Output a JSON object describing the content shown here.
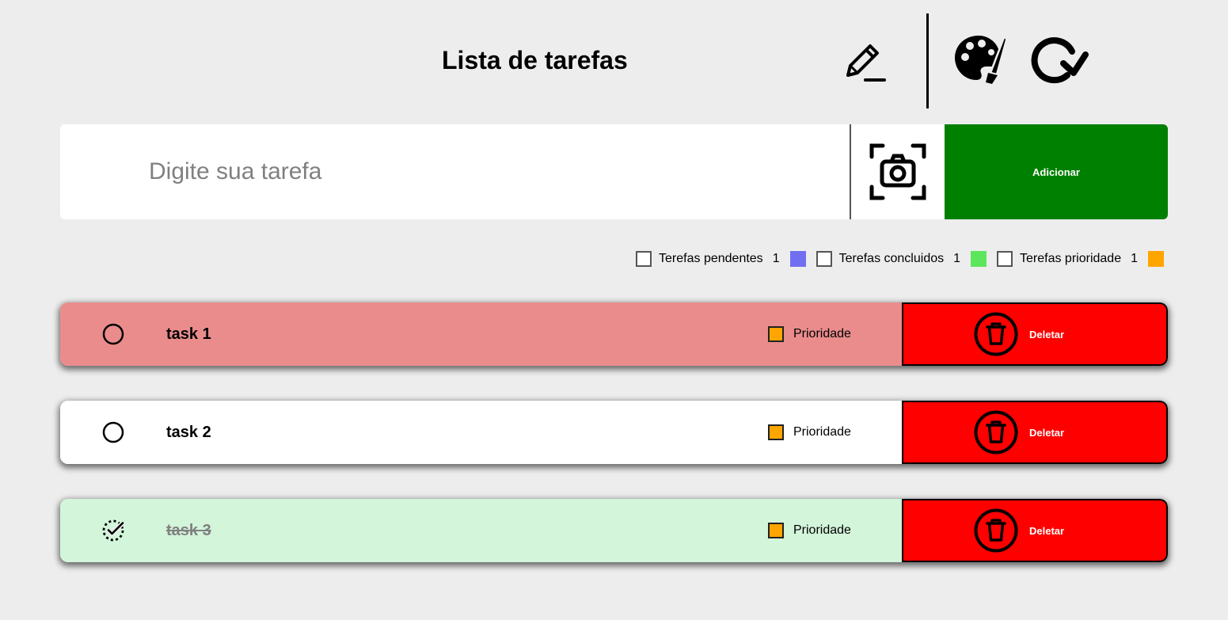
{
  "header": {
    "title": "Lista de tarefas",
    "icons": [
      "edit-icon",
      "palette-icon",
      "redo-icon"
    ]
  },
  "input": {
    "placeholder": "Digite sua tarefa",
    "value": "",
    "camera_icon": "camera-scan-icon",
    "add_label": "Adicionar"
  },
  "filters": [
    {
      "label": "Terefas pendentes",
      "count": "1",
      "color": "#6f6ff0"
    },
    {
      "label": "Terefas concluidos",
      "count": "1",
      "color": "#5ce65c"
    },
    {
      "label": "Terefas prioridade",
      "count": "1",
      "color": "#ffa500"
    }
  ],
  "tasks": [
    {
      "text": "task 1",
      "status": "pending",
      "bg": "#ea8c8c",
      "priority_label": "Prioridade",
      "delete_label": "Deletar"
    },
    {
      "text": "task 2",
      "status": "pending",
      "bg": "#ffffff",
      "priority_label": "Prioridade",
      "delete_label": "Deletar"
    },
    {
      "text": "task 3",
      "status": "done",
      "bg": "#d3f5da",
      "priority_label": "Prioridade",
      "delete_label": "Deletar"
    }
  ],
  "colors": {
    "add_button": "#008000",
    "delete_button": "#ff0000",
    "priority_swatch": "#ffa500",
    "background": "#ededed"
  }
}
